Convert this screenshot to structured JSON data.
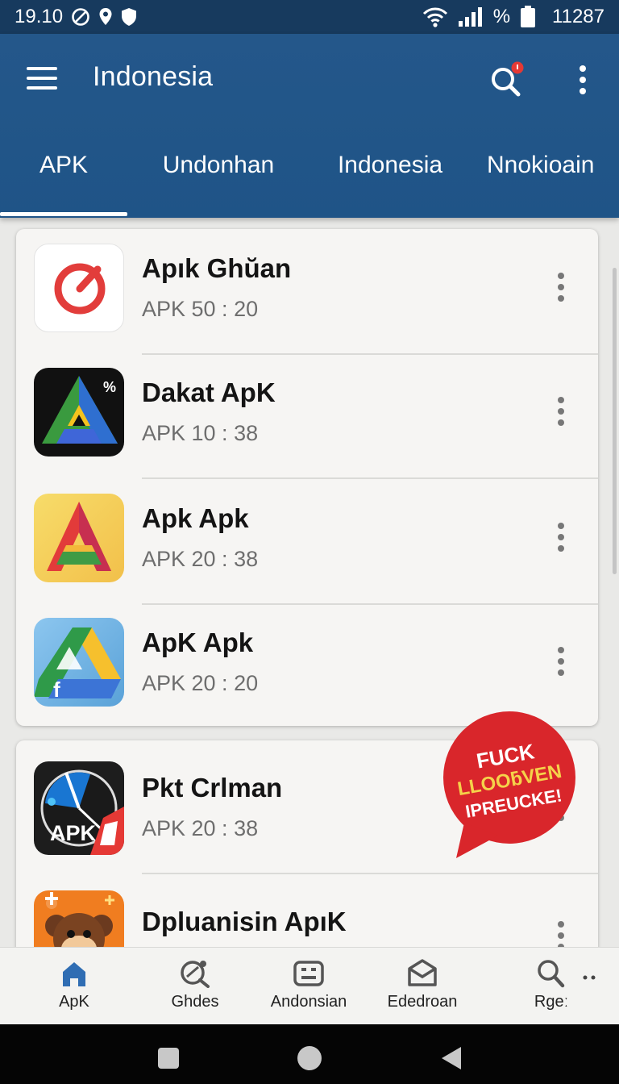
{
  "status_bar": {
    "time": "19.10",
    "percent_symbol": "%",
    "right_text": "11287",
    "icons": [
      "blocked-circle-icon",
      "location-pin-icon",
      "shield-icon",
      "wifi-icon",
      "signal-icon",
      "battery-icon"
    ]
  },
  "app_bar": {
    "title": "Indonesia",
    "icons": [
      "menu-icon",
      "search-icon",
      "more-vert-icon"
    ],
    "notification_dot_color": "#e53935"
  },
  "tabs": [
    {
      "label": "APK",
      "selected": true
    },
    {
      "label": "Undonhan",
      "selected": false
    },
    {
      "label": "Indonesia",
      "selected": false
    },
    {
      "label": "Nnokioain",
      "selected": false
    }
  ],
  "apps": [
    {
      "name": "Apık Ghŭan",
      "sub": "APK 50 : 20",
      "icon": "red-ring-icon"
    },
    {
      "name": "Dakat ApK",
      "sub": "APK 10 : 38",
      "icon": "triangle-dark-icon",
      "badge": "%"
    },
    {
      "name": "Apk Apk",
      "sub": "APK 20 : 38",
      "icon": "triangle-yellow-icon"
    },
    {
      "name": "ApK Apk",
      "sub": "APK 20 : 20",
      "icon": "triangle-drive-icon"
    },
    {
      "name": "Pkt Crlman",
      "sub": "APK 20 : 38",
      "icon": "gauge-apk-icon",
      "icon_text": "APK"
    },
    {
      "name": "Dpluanisin ApıK",
      "sub": "",
      "icon": "monkey-icon"
    }
  ],
  "sticker": {
    "lines": [
      "FUCK",
      "LLOOƃVEN",
      "IPREUCKE!"
    ],
    "color": "#d9262b",
    "text_color": "#f5d24a"
  },
  "bottom_nav": [
    {
      "label": "ApK",
      "icon": "home-icon",
      "active": true
    },
    {
      "label": "Ghdes",
      "icon": "search-doc-icon"
    },
    {
      "label": "Andonsian",
      "icon": "grid-icon"
    },
    {
      "label": "Ededroan",
      "icon": "mail-icon"
    },
    {
      "label": "Rgeː",
      "icon": "search-icon"
    }
  ],
  "colors": {
    "app_bar": "#24578a",
    "status_bar": "#173a5e",
    "active_nav": "#2f6db3"
  }
}
